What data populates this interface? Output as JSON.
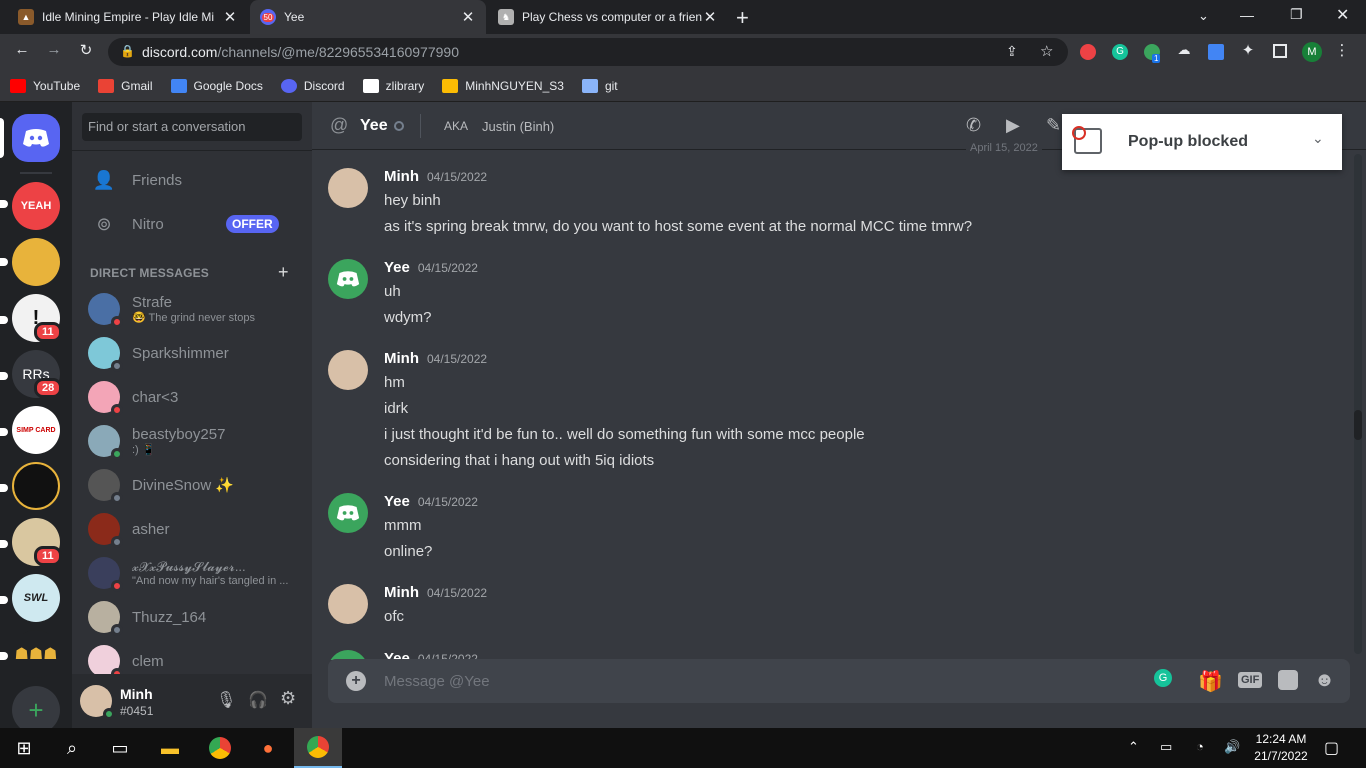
{
  "browser": {
    "tabs": [
      {
        "title": "Idle Mining Empire - Play Idle Mi",
        "icon": "mining-icon"
      },
      {
        "title": "Yee",
        "icon": "discord-notification-icon",
        "badge": "50"
      },
      {
        "title": "Play Chess vs computer or a frien",
        "icon": "chess-icon"
      }
    ],
    "new_tab": "+",
    "url_host": "discord.com",
    "url_path": "/channels/@me/822965534160977990",
    "bookmarks": [
      {
        "label": "YouTube",
        "color": "#ff0000"
      },
      {
        "label": "Gmail",
        "color": "#ea4335"
      },
      {
        "label": "Google Docs",
        "color": "#4285f4"
      },
      {
        "label": "Discord",
        "color": "#5865f2"
      },
      {
        "label": "zlibrary",
        "color": "#ffffff"
      },
      {
        "label": "MinhNGUYEN_S3",
        "color": "#fbbc04"
      },
      {
        "label": "git",
        "color": "#8ab4f8"
      }
    ],
    "extension_badge": "1"
  },
  "guilds": [
    {
      "label": "",
      "color": "#5865f2",
      "badge": ""
    },
    {
      "label": "YEAH",
      "color": "#ed4245",
      "badge": ""
    },
    {
      "label": "",
      "color": "#e8b33b",
      "badge": ""
    },
    {
      "label": "",
      "color": "#f2f2f2",
      "badge": "11"
    },
    {
      "label": "RRs",
      "color": "#36393f",
      "badge": "28"
    },
    {
      "label": "SIMP CARD",
      "color": "#ffffff",
      "badge": ""
    },
    {
      "label": "",
      "color": "#111111",
      "badge": ""
    },
    {
      "label": "",
      "color": "#d9c7a0",
      "badge": "11"
    },
    {
      "label": "SWL",
      "color": "#cfe9f0",
      "badge": ""
    },
    {
      "label": "",
      "color": "#202225",
      "badge": ""
    }
  ],
  "sidebar": {
    "search_placeholder": "Find or start a conversation",
    "friends_label": "Friends",
    "nitro_label": "Nitro",
    "offer_label": "OFFER",
    "dm_header": "DIRECT MESSAGES",
    "dm_add": "+",
    "dms": [
      {
        "name": "Strafe",
        "sub": "🤓 The grind never stops",
        "avatar": "#4a6fa5",
        "status": "#ed4245"
      },
      {
        "name": "Sparkshimmer",
        "sub": "",
        "avatar": "#7ec8d8",
        "status": "#747f8d"
      },
      {
        "name": "char<3",
        "sub": "",
        "avatar": "#f3a5b7",
        "status": "#ed4245"
      },
      {
        "name": "beastyboy257",
        "sub": ":) 📱",
        "avatar": "#8aa9b8",
        "status": "#3ba55d"
      },
      {
        "name": "DivineSnow ✨",
        "sub": "",
        "avatar": "#555555",
        "status": "#747f8d"
      },
      {
        "name": "asher",
        "sub": "",
        "avatar": "#8b2a1a",
        "status": "#747f8d"
      },
      {
        "name": "𝔁𝓧𝔁𝓟𝓾𝓼𝓼𝔂𝓢𝓵𝓪𝔂𝓮𝓻...",
        "sub": "\"And now my hair's tangled in ...",
        "avatar": "#3a3f5c",
        "status": "#ed4245"
      },
      {
        "name": "Thuzz_164",
        "sub": "",
        "avatar": "#b8b0a0",
        "status": "#747f8d"
      },
      {
        "name": "clem",
        "sub": "",
        "avatar": "#f0d0dc",
        "status": "#ed4245"
      }
    ]
  },
  "user": {
    "name": "Minh",
    "tag": "#0451"
  },
  "chat": {
    "name": "Yee",
    "aka_label": "AKA",
    "aka_value": "Justin (Binh)",
    "date_divider": "April 15, 2022",
    "messages": [
      {
        "author": "Minh",
        "time": "04/15/2022",
        "avatar": "minh",
        "lines": [
          "hey binh",
          "as it's spring break tmrw, do you want to host some event at the normal MCC time tmrw?"
        ]
      },
      {
        "author": "Yee",
        "time": "04/15/2022",
        "avatar": "discord",
        "lines": [
          "uh",
          "wdym?"
        ]
      },
      {
        "author": "Minh",
        "time": "04/15/2022",
        "avatar": "minh",
        "lines": [
          "hm",
          "idrk",
          "i just thought it'd be fun to.. well do something fun with some mcc people",
          "considering that i hang out with 5iq idiots"
        ]
      },
      {
        "author": "Yee",
        "time": "04/15/2022",
        "avatar": "discord",
        "lines": [
          "mmm",
          "online?"
        ]
      },
      {
        "author": "Minh",
        "time": "04/15/2022",
        "avatar": "minh",
        "lines": [
          "ofc"
        ]
      },
      {
        "author": "Yee",
        "time": "04/15/2022",
        "avatar": "discord",
        "lines": []
      }
    ],
    "composer_placeholder": "Message @Yee",
    "gif_label": "GIF"
  },
  "popup": {
    "label": "Pop-up blocked"
  },
  "taskbar": {
    "time": "12:24 AM",
    "date": "21/7/2022"
  }
}
